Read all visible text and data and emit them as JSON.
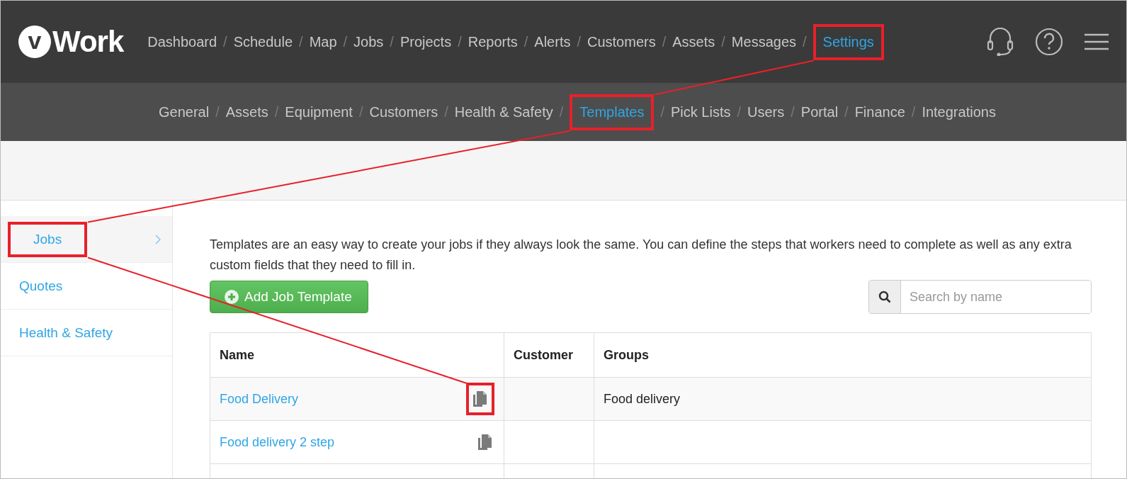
{
  "logo": {
    "mark": "v",
    "text": "Work"
  },
  "nav_separator": "/",
  "top_nav": [
    {
      "label": "Dashboard",
      "selected": false,
      "highlighted": false
    },
    {
      "label": "Schedule",
      "selected": false,
      "highlighted": false
    },
    {
      "label": "Map",
      "selected": false,
      "highlighted": false
    },
    {
      "label": "Jobs",
      "selected": false,
      "highlighted": false
    },
    {
      "label": "Projects",
      "selected": false,
      "highlighted": false
    },
    {
      "label": "Reports",
      "selected": false,
      "highlighted": false
    },
    {
      "label": "Alerts",
      "selected": false,
      "highlighted": false
    },
    {
      "label": "Customers",
      "selected": false,
      "highlighted": false
    },
    {
      "label": "Assets",
      "selected": false,
      "highlighted": false
    },
    {
      "label": "Messages",
      "selected": false,
      "highlighted": false
    },
    {
      "label": "Settings",
      "selected": true,
      "highlighted": true
    }
  ],
  "sub_nav": [
    {
      "label": "General",
      "selected": false,
      "highlighted": false
    },
    {
      "label": "Assets",
      "selected": false,
      "highlighted": false
    },
    {
      "label": "Equipment",
      "selected": false,
      "highlighted": false
    },
    {
      "label": "Customers",
      "selected": false,
      "highlighted": false
    },
    {
      "label": "Health & Safety",
      "selected": false,
      "highlighted": false
    },
    {
      "label": "Templates",
      "selected": true,
      "highlighted": true
    },
    {
      "label": "Pick Lists",
      "selected": false,
      "highlighted": false
    },
    {
      "label": "Users",
      "selected": false,
      "highlighted": false
    },
    {
      "label": "Portal",
      "selected": false,
      "highlighted": false
    },
    {
      "label": "Finance",
      "selected": false,
      "highlighted": false
    },
    {
      "label": "Integrations",
      "selected": false,
      "highlighted": false
    }
  ],
  "sidebar": {
    "items": [
      {
        "label": "Jobs",
        "selected": true,
        "highlighted": true
      },
      {
        "label": "Quotes",
        "selected": false,
        "highlighted": false
      },
      {
        "label": "Health & Safety",
        "selected": false,
        "highlighted": false
      }
    ]
  },
  "intro": "Templates are an easy way to create your jobs if they always look the same. You can define the steps that workers need to complete as well as any extra custom fields that they need to fill in.",
  "add_button": {
    "label": "Add Job Template"
  },
  "search": {
    "placeholder": "Search by name"
  },
  "table": {
    "columns": [
      "Name",
      "Customer",
      "Groups"
    ],
    "rows": [
      {
        "name": "Food Delivery",
        "groups": "Food delivery",
        "icon_highlighted": true
      },
      {
        "name": "Food delivery 2 step",
        "icon_highlighted": false
      }
    ]
  }
}
